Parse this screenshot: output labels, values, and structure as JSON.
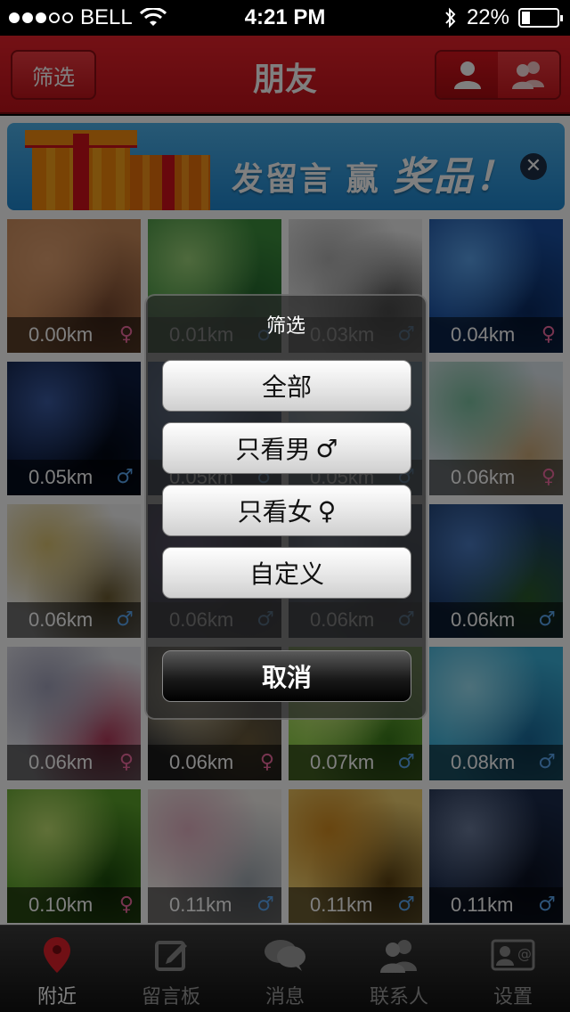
{
  "status_bar": {
    "carrier": "BELL",
    "time": "4:21 PM",
    "battery": "22%",
    "battery_level": 0.22
  },
  "navbar": {
    "title": "朋友",
    "filter_label": "筛选"
  },
  "banner": {
    "text_part1": "发留言",
    "text_part2": "赢",
    "text_part3": "奖品！"
  },
  "tiles": [
    {
      "distance": "0.00km",
      "gender": "♀",
      "colors": [
        "#c98a5a",
        "#e0a070",
        "#7a4a30"
      ]
    },
    {
      "distance": "0.01km",
      "gender": "♂",
      "colors": [
        "#3d8f3d",
        "#9dd37a",
        "#1f5f2a"
      ]
    },
    {
      "distance": "0.03km",
      "gender": "♂",
      "colors": [
        "#eeeeee",
        "#b0b0b0",
        "#3a3a3a"
      ]
    },
    {
      "distance": "0.04km",
      "gender": "♀",
      "colors": [
        "#1a4fa0",
        "#5aa0e8",
        "#0a2a60"
      ]
    },
    {
      "distance": "0.05km",
      "gender": "♂",
      "colors": [
        "#0d1c40",
        "#3a5aa0",
        "#020814"
      ]
    },
    {
      "distance": "0.05km",
      "gender": "♂",
      "colors": [
        "#2a4f8a",
        "#6a8fd0",
        "#10203f"
      ]
    },
    {
      "distance": "0.05km",
      "gender": "♂",
      "colors": [
        "#87b6d8",
        "#d8e8f4",
        "#4a7a9a"
      ]
    },
    {
      "distance": "0.06km",
      "gender": "♀",
      "colors": [
        "#dfe8ef",
        "#7cc0a0",
        "#c9a878"
      ]
    },
    {
      "distance": "0.06km",
      "gender": "♂",
      "colors": [
        "#f4f4f4",
        "#d8c070",
        "#6a5a30"
      ]
    },
    {
      "distance": "0.06km",
      "gender": "♂",
      "colors": [
        "#1a1a3a",
        "#4a3a7a",
        "#0a0a1a"
      ]
    },
    {
      "distance": "0.06km",
      "gender": "♂",
      "colors": [
        "#2a3a5a",
        "#6a7aa0",
        "#111a2a"
      ]
    },
    {
      "distance": "0.06km",
      "gender": "♂",
      "colors": [
        "#1a3a6a",
        "#4a7ac0",
        "#2a5a2a"
      ]
    },
    {
      "distance": "0.06km",
      "gender": "♀",
      "colors": [
        "#e8e8ee",
        "#a0a0b8",
        "#b03a5a"
      ]
    },
    {
      "distance": "0.06km",
      "gender": "♀",
      "colors": [
        "#3a3a3a",
        "#d8c8a0",
        "#6a5a3a"
      ]
    },
    {
      "distance": "0.07km",
      "gender": "♂",
      "colors": [
        "#8fd04a",
        "#d8f08a",
        "#3a7a1a"
      ]
    },
    {
      "distance": "0.08km",
      "gender": "♂",
      "colors": [
        "#3ab0d8",
        "#9ae0f4",
        "#1a6a9a"
      ]
    },
    {
      "distance": "0.10km",
      "gender": "♀",
      "colors": [
        "#5aa02a",
        "#c0e070",
        "#1a4a0a"
      ]
    },
    {
      "distance": "0.11km",
      "gender": "♂",
      "colors": [
        "#f4f0ec",
        "#e0b0c0",
        "#a0a8b0"
      ]
    },
    {
      "distance": "0.11km",
      "gender": "♂",
      "colors": [
        "#f0d070",
        "#d08a20",
        "#5a4010"
      ]
    },
    {
      "distance": "0.11km",
      "gender": "♂",
      "colors": [
        "#1a2a4a",
        "#6a7a9a",
        "#0a1020"
      ]
    }
  ],
  "dialog": {
    "title": "筛选",
    "options": [
      {
        "label": "全部",
        "symbol": ""
      },
      {
        "label": "只看男",
        "symbol": "♂"
      },
      {
        "label": "只看女",
        "symbol": "♀"
      },
      {
        "label": "自定义",
        "symbol": ""
      }
    ],
    "cancel_label": "取消"
  },
  "tabbar": {
    "items": [
      {
        "label": "附近",
        "icon": "location-pin-icon",
        "active": true
      },
      {
        "label": "留言板",
        "icon": "compose-icon",
        "active": false
      },
      {
        "label": "消息",
        "icon": "chat-bubbles-icon",
        "active": false
      },
      {
        "label": "联系人",
        "icon": "contacts-icon",
        "active": false
      },
      {
        "label": "设置",
        "icon": "settings-card-icon",
        "active": false
      }
    ]
  },
  "colors": {
    "accent_red": "#d0131b",
    "female": "#f06aa0",
    "male": "#5aa6f0"
  }
}
